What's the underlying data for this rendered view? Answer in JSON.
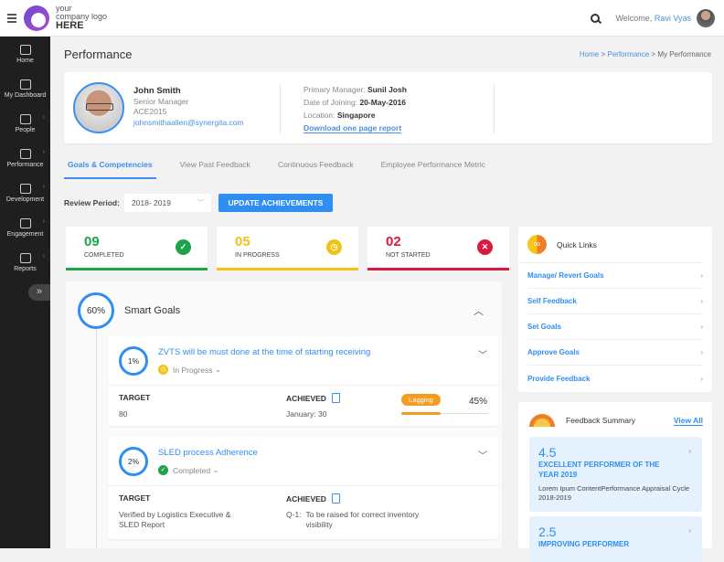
{
  "topbar": {
    "logo_line1": "your",
    "logo_line2": "company logo",
    "logo_line3": "HERE",
    "welcome_prefix": "Welcome,",
    "user_name": "Ravi Vyas"
  },
  "sidebar": {
    "items": [
      {
        "label": "Home",
        "icon": "home-icon",
        "has_arrow": false
      },
      {
        "label": "My Dashboard",
        "icon": "monitor-icon",
        "has_arrow": false
      },
      {
        "label": "People",
        "icon": "people-icon",
        "has_arrow": true
      },
      {
        "label": "Performance",
        "icon": "gauge-icon",
        "has_arrow": true
      },
      {
        "label": "Development",
        "icon": "book-icon",
        "has_arrow": true
      },
      {
        "label": "Engagement",
        "icon": "chat-icon",
        "has_arrow": true
      },
      {
        "label": "Reports",
        "icon": "report-icon",
        "has_arrow": true
      }
    ],
    "collapse_glyph": "»"
  },
  "header": {
    "title": "Performance",
    "breadcrumb": {
      "home": "Home",
      "sep": ">",
      "performance": "Performance",
      "current": "My Performance"
    }
  },
  "profile": {
    "name": "John Smith",
    "role": "Senior Manager",
    "id": "ACE2015",
    "email": "johnsmithaallen@synergita.com",
    "manager_label": "Primary Manager:",
    "manager": "Sunil Josh",
    "doj_label": "Date of Joining:",
    "doj": "20-May-2016",
    "location_label": "Location:",
    "location": "Singapore",
    "download_link": "Download one page report"
  },
  "tabs": [
    {
      "label": "Goals & Competencies",
      "active": true
    },
    {
      "label": "View Past Feedback",
      "active": false
    },
    {
      "label": "Continuous Feedback",
      "active": false
    },
    {
      "label": "Employee Performance Metric",
      "active": false
    }
  ],
  "review": {
    "label": "Review Period:",
    "selected": "2018- 2019",
    "button": "UPDATE ACHIEVEMENTS"
  },
  "stats": [
    {
      "value": "09",
      "label": "COMPLETED",
      "color": "#1ea24a",
      "glyph": "✓"
    },
    {
      "value": "05",
      "label": "IN PROGRESS",
      "color": "#f2c315",
      "glyph": "◷"
    },
    {
      "value": "02",
      "label": "NOT STARTED",
      "color": "#d81b3f",
      "glyph": "✕"
    }
  ],
  "smart_goals": {
    "percent": "60%",
    "title": "Smart Goals",
    "goals": [
      {
        "percent": "1%",
        "title": "ZVTS will be must done at the time of starting receiving",
        "status": "In Progress",
        "status_color": "#f2c315",
        "target_label": "TARGET",
        "target": "80",
        "achieved_label": "ACHIEVED",
        "achieved": "January:  30",
        "badge": "Lagging",
        "progress_percent": "45%",
        "progress_value": 45
      },
      {
        "percent": "2%",
        "title": "SLED process Adherence",
        "status": "Completed",
        "status_color": "#1ea24a",
        "target_label": "TARGET",
        "target": "Verified by Logistics Executive & SLED Report",
        "achieved_label": "ACHIEVED",
        "achieved_prefix": "Q-1:",
        "achieved": "To be raised for correct inventory visibility"
      }
    ]
  },
  "quick_links": {
    "title": "Quick Links",
    "items": [
      "Manage/ Revert Goals",
      "Self Feedback",
      "Set Goals",
      "Approve Goals",
      "Provide Feedback"
    ]
  },
  "feedback_summary": {
    "title": "Feedback Summary",
    "view_all": "View All",
    "items": [
      {
        "score": "4.5",
        "title": "EXCELLENT PERFORMER OF THE YEAR 2019",
        "desc": "Lorem Ipum ContentPerformance Appraisal Cycle 2018-2019"
      },
      {
        "score": "2.5",
        "title": "IMPROVING PERFORMER",
        "desc": ""
      }
    ]
  }
}
